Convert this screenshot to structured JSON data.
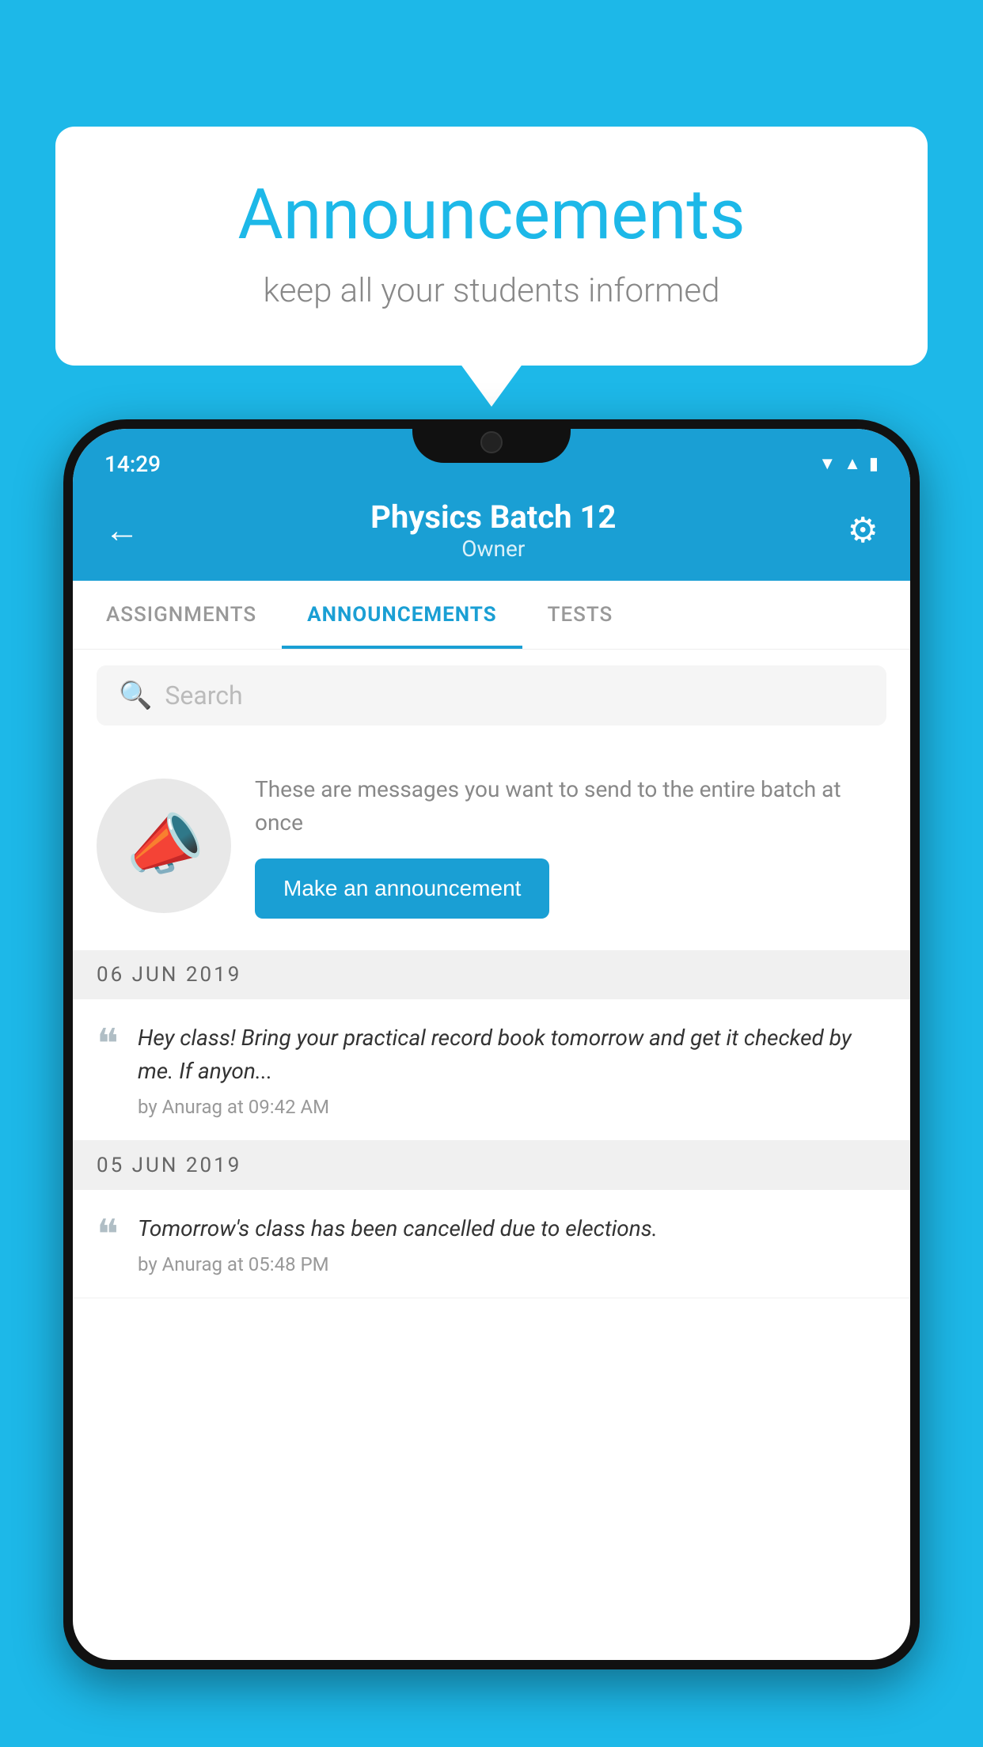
{
  "background_color": "#1db8e8",
  "bubble": {
    "title": "Announcements",
    "subtitle": "keep all your students informed"
  },
  "status_bar": {
    "time": "14:29",
    "icons": [
      "wifi",
      "signal",
      "battery"
    ]
  },
  "header": {
    "title": "Physics Batch 12",
    "subtitle": "Owner",
    "back_label": "←",
    "gear_label": "⚙"
  },
  "tabs": [
    {
      "label": "ASSIGNMENTS",
      "active": false
    },
    {
      "label": "ANNOUNCEMENTS",
      "active": true
    },
    {
      "label": "TESTS",
      "active": false
    }
  ],
  "search": {
    "placeholder": "Search"
  },
  "promo": {
    "description": "These are messages you want to send to the entire batch at once",
    "button_label": "Make an announcement"
  },
  "announcements": [
    {
      "date": "06  JUN  2019",
      "text": "Hey class! Bring your practical record book tomorrow and get it checked by me. If anyon...",
      "meta": "by Anurag at 09:42 AM"
    },
    {
      "date": "05  JUN  2019",
      "text": "Tomorrow's class has been cancelled due to elections.",
      "meta": "by Anurag at 05:48 PM"
    }
  ]
}
